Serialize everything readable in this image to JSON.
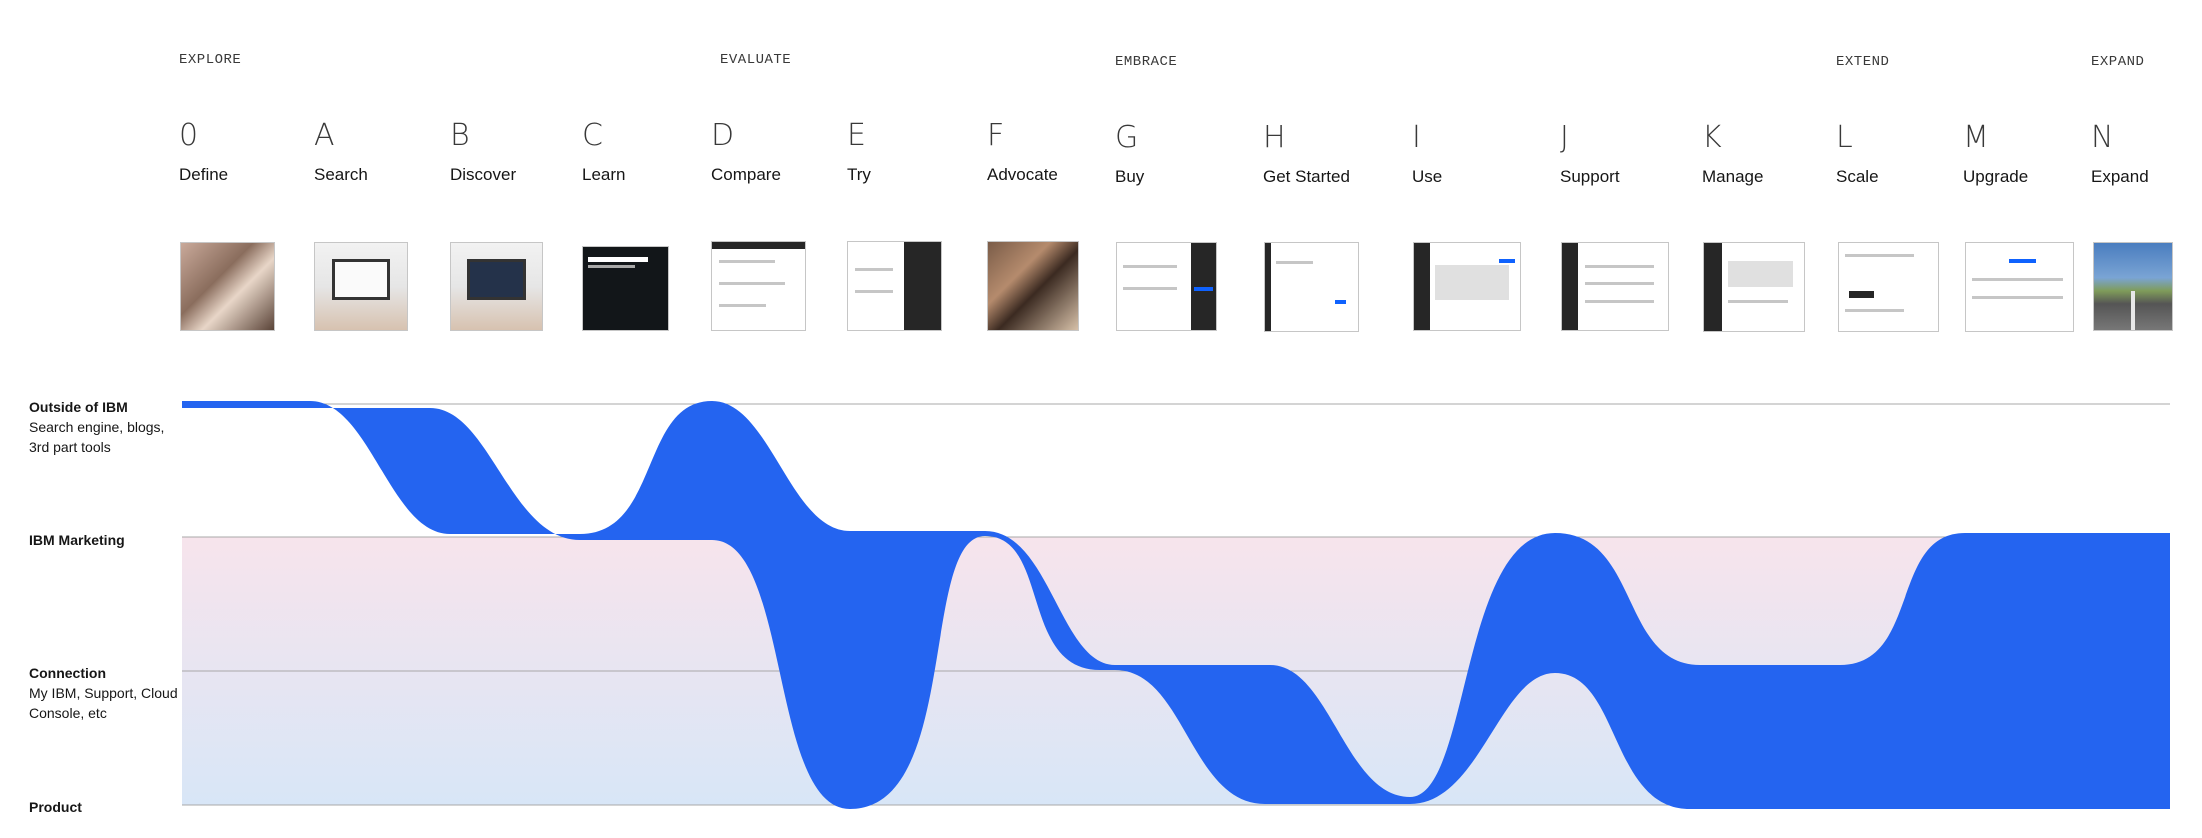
{
  "phases": [
    {
      "label": "EXPLORE"
    },
    {
      "label": "EVALUATE"
    },
    {
      "label": "EMBRACE"
    },
    {
      "label": "EXTEND"
    },
    {
      "label": "EXPAND"
    }
  ],
  "stages": [
    {
      "letter": "0",
      "name": "Define"
    },
    {
      "letter": "A",
      "name": "Search"
    },
    {
      "letter": "B",
      "name": "Discover"
    },
    {
      "letter": "C",
      "name": "Learn"
    },
    {
      "letter": "D",
      "name": "Compare"
    },
    {
      "letter": "E",
      "name": "Try"
    },
    {
      "letter": "F",
      "name": "Advocate"
    },
    {
      "letter": "G",
      "name": "Buy"
    },
    {
      "letter": "H",
      "name": "Get Started"
    },
    {
      "letter": "I",
      "name": "Use"
    },
    {
      "letter": "J",
      "name": "Support"
    },
    {
      "letter": "K",
      "name": "Manage"
    },
    {
      "letter": "L",
      "name": "Scale"
    },
    {
      "letter": "M",
      "name": "Upgrade"
    },
    {
      "letter": "N",
      "name": "Expand"
    }
  ],
  "lanes": [
    {
      "title": "Outside of IBM",
      "subtitle": "Search engine, blogs, 3rd part tools"
    },
    {
      "title": "IBM Marketing",
      "subtitle": ""
    },
    {
      "title": "Connection",
      "subtitle": "My IBM, Support, Cloud Console, etc"
    },
    {
      "title": "Product",
      "subtitle": ""
    }
  ],
  "flow": {
    "color": "#2464f0",
    "lane_tint_top": "#f7e4ec",
    "lane_tint_bottom": "#d8e6f7",
    "grid_color": "#a8a8a8",
    "band_per_stage": [
      {
        "stage": "0",
        "lanes": [
          "Outside of IBM"
        ]
      },
      {
        "stage": "A",
        "lanes": [
          "Outside of IBM"
        ]
      },
      {
        "stage": "B",
        "lanes": [
          "IBM Marketing"
        ]
      },
      {
        "stage": "C",
        "lanes": [
          "IBM Marketing"
        ]
      },
      {
        "stage": "D",
        "lanes": [
          "Outside of IBM",
          "IBM Marketing"
        ]
      },
      {
        "stage": "E",
        "lanes": [
          "IBM Marketing",
          "Product"
        ]
      },
      {
        "stage": "F",
        "lanes": [
          "IBM Marketing"
        ]
      },
      {
        "stage": "G",
        "lanes": [
          "Connection"
        ]
      },
      {
        "stage": "H",
        "lanes": [
          "Connection",
          "Product"
        ]
      },
      {
        "stage": "I",
        "lanes": [
          "Product"
        ]
      },
      {
        "stage": "J",
        "lanes": [
          "IBM Marketing",
          "Product"
        ]
      },
      {
        "stage": "K",
        "lanes": [
          "Connection",
          "Product"
        ]
      },
      {
        "stage": "L",
        "lanes": [
          "Connection",
          "Product"
        ]
      },
      {
        "stage": "M",
        "lanes": [
          "IBM Marketing",
          "Product"
        ]
      },
      {
        "stage": "N",
        "lanes": [
          "IBM Marketing",
          "Product"
        ]
      }
    ]
  }
}
